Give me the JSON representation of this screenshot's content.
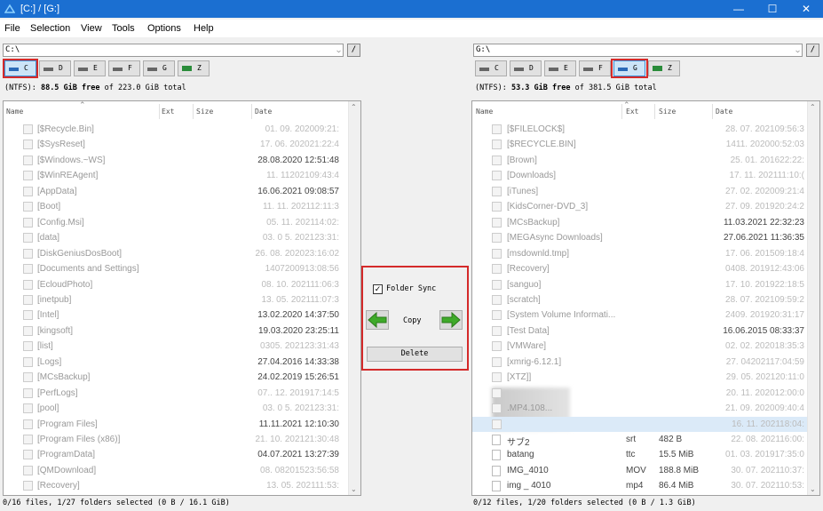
{
  "window": {
    "title": "[C:] / [G:]",
    "minimize": "—",
    "maximize": "☐",
    "close": "✕"
  },
  "menu": [
    "File",
    "Selection",
    "View",
    "Tools",
    "Options",
    "Help"
  ],
  "left": {
    "path": "C:\\",
    "slash": "/",
    "drives": [
      "C",
      "D",
      "E",
      "F",
      "G",
      "Z"
    ],
    "active_drive": "C",
    "fs_prefix": "(NTFS): ",
    "free_amount": "88.5 GiB free",
    "free_suffix": " of 223.0 GiB total",
    "headers": {
      "name": "Name",
      "ext": "Ext",
      "size": "Size",
      "date": "Date"
    },
    "rows": [
      {
        "name": "[$Recycle.Bin]",
        "date": "01. 09. 202009:21:"
      },
      {
        "name": "[$SysReset]",
        "date": "17. 06. 202021:22:4"
      },
      {
        "name": "[$Windows.~WS]",
        "date": "28.08.2020 12:51:48"
      },
      {
        "name": "[$WinREAgent]",
        "date": "11. 11202109:43:4"
      },
      {
        "name": "[AppData]",
        "date": "16.06.2021 09:08:57"
      },
      {
        "name": "[Boot]",
        "date": "11. 11. 202112:11:3"
      },
      {
        "name": "[Config.Msi]",
        "date": "05. 11. 202114:02:"
      },
      {
        "name": "[data]",
        "date": "03. 0 5. 202123:31:"
      },
      {
        "name": "[DiskGeniusDosBoot]",
        "date": "26. 08. 202023:16:02"
      },
      {
        "name": "[Documents and Settings]",
        "date": "1407200913:08:56"
      },
      {
        "name": "[EcloudPhoto]",
        "date": "08. 10. 202111:06:3"
      },
      {
        "name": "[inetpub]",
        "date": "13. 05. 202111:07:3"
      },
      {
        "name": "[Intel]",
        "date": "13.02.2020 14:37:50"
      },
      {
        "name": "[kingsoft]",
        "date": "19.03.2020 23:25:11"
      },
      {
        "name": "[list]",
        "date": "0305. 202123:31:43"
      },
      {
        "name": "[Logs]",
        "date": "27.04.2016 14:33:38"
      },
      {
        "name": "[MCsBackup]",
        "date": "24.02.2019 15:26:51"
      },
      {
        "name": "[PerfLogs]",
        "date": "07.. 12. 201917:14:5"
      },
      {
        "name": "[pool]",
        "date": "03. 0 5. 202123:31:"
      },
      {
        "name": "[Program Files]",
        "date": "11.11.2021 12:10:30"
      },
      {
        "name": "[Program Files (x86)]",
        "date": "21. 10. 202121:30:48"
      },
      {
        "name": "[ProgramData]",
        "date": "04.07.2021 13:27:39"
      },
      {
        "name": "[QMDownload]",
        "date": "08. 08201523:56:58"
      },
      {
        "name": "[Recovery]",
        "date": "13. 05. 202111:53:"
      }
    ],
    "status": "0/16 files, 1/27 folders selected (0 B / 16.1 GiB)"
  },
  "middle": {
    "sync_label": "Folder Sync",
    "sync_checked": "✓",
    "copy_label": "Copy",
    "delete_label": "Delete"
  },
  "right": {
    "path": "G:\\",
    "slash": "/",
    "drives": [
      "C",
      "D",
      "E",
      "F",
      "G",
      "Z"
    ],
    "active_drive": "G",
    "fs_prefix": "(NTFS): ",
    "free_amount": "53.3 GiB free",
    "free_suffix": " of 381.5 GiB total",
    "headers": {
      "name": "Name",
      "ext": "Ext",
      "size": "Size",
      "date": "Date"
    },
    "rows": [
      {
        "name": "[$FILELOCK$]",
        "date": "28. 07. 202109:56:3"
      },
      {
        "name": "[$RECYCLE.BIN]",
        "date": "1411. 202000:52:03"
      },
      {
        "name": "[Brown]",
        "date": "25. 01. 201622:22:"
      },
      {
        "name": "[Downloads]",
        "date": "17. 11. 202111:10:("
      },
      {
        "name": "[iTunes]",
        "date": "27. 02. 202009:21:4"
      },
      {
        "name": "[KidsCorner-DVD_3]",
        "date": "27. 09. 201920:24:2"
      },
      {
        "name": "[MCsBackup]",
        "date": "11.03.2021 22:32:23"
      },
      {
        "name": "[MEGAsync Downloads]",
        "date": "27.06.2021 11:36:35"
      },
      {
        "name": "[msdownld.tmp]",
        "date": "17. 06. 201509:18:4"
      },
      {
        "name": "[Recovery]",
        "date": "0408. 201912:43:06"
      },
      {
        "name": "[sanguo]",
        "date": "17. 10. 201922:18:5"
      },
      {
        "name": "[scratch]",
        "date": "28. 07. 202109:59:2"
      },
      {
        "name": "[System Volume Informati...",
        "date": "2409. 201920:31:17"
      },
      {
        "name": "[Test Data]",
        "date": "16.06.2015 08:33:37"
      },
      {
        "name": "[VMWare]",
        "date": "02. 02. 202018:35:3"
      },
      {
        "name": "[xmrig-6.12.1]",
        "date": "27. 04202117:04:59"
      },
      {
        "name": "[XTZ]]",
        "date": "29. 05. 202120:11:0"
      },
      {
        "name": "",
        "date": "20. 11. 202012:00:0"
      },
      {
        "name": ".MP4.108...",
        "date": "21. 09. 202009:40:4"
      },
      {
        "name": "",
        "date": "16. 11. 202118:04:"
      },
      {
        "name": "サブ2",
        "ext": "srt",
        "size": "482 B",
        "date": "22. 08. 202116:00:"
      },
      {
        "name": "batang",
        "ext": "ttc",
        "size": "15.5 MiB",
        "date": "01. 03. 201917:35:0"
      },
      {
        "name": "IMG_4010",
        "ext": "MOV",
        "size": "188.8 MiB",
        "date": "30. 07. 202110:37:"
      },
      {
        "name": "img _ 4010",
        "ext": "mp4",
        "size": "86.4 MiB",
        "date": "30. 07. 202110:53:"
      }
    ],
    "status": "0/12 files, 1/20 folders selected (0 B / 1.3 GiB)"
  }
}
